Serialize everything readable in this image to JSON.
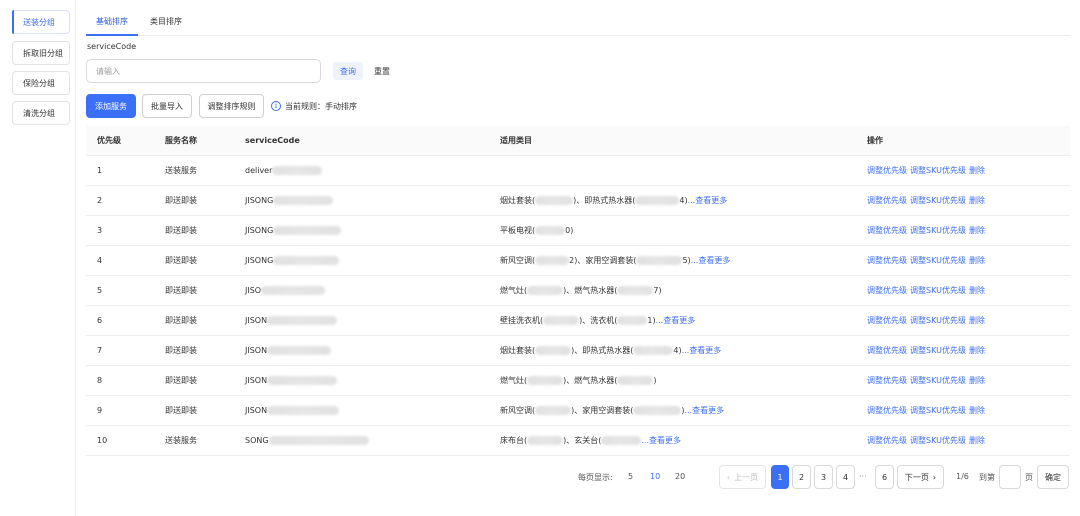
{
  "sidebar": {
    "items": [
      {
        "label": "送装分组",
        "active": true
      },
      {
        "label": "拆取旧分组",
        "active": false
      },
      {
        "label": "保险分组",
        "active": false
      },
      {
        "label": "清洗分组",
        "active": false
      }
    ]
  },
  "tabs": [
    {
      "label": "基础排序",
      "active": true
    },
    {
      "label": "类目排序",
      "active": false
    }
  ],
  "filter": {
    "label": "serviceCode",
    "placeholder": "请输入",
    "value": "",
    "query_label": "查询",
    "reset_label": "重置"
  },
  "actions": {
    "add_label": "添加服务",
    "import_label": "批量导入",
    "adjust_rule_label": "调整排序规则",
    "current_rule_text": "当前规则：手动排序"
  },
  "table": {
    "headers": [
      "优先级",
      "服务名称",
      "serviceCode",
      "适用类目",
      "操作"
    ],
    "rows": [
      {
        "priority": "1",
        "name": "送装服务",
        "code": "deliver",
        "category": "",
        "more": ""
      },
      {
        "priority": "2",
        "name": "即送即装",
        "code": "JISONG",
        "category_parts": [
          "烟灶套装(",
          ")、即热式热水器(",
          "4)"
        ],
        "category": "",
        "more": "...查看更多"
      },
      {
        "priority": "3",
        "name": "即送即装",
        "code": "JISONG",
        "category_parts": [
          "平板电视(",
          "0)"
        ],
        "category": "",
        "more": ""
      },
      {
        "priority": "4",
        "name": "即送即装",
        "code": "JISONG",
        "category_parts": [
          "新风空调(",
          "2)、家用空调套装(",
          "5)"
        ],
        "category": "",
        "more": "...查看更多"
      },
      {
        "priority": "5",
        "name": "即送即装",
        "code": "JISO",
        "category_parts": [
          "燃气灶(",
          ")、燃气热水器(",
          "7)"
        ],
        "category": "",
        "more": ""
      },
      {
        "priority": "6",
        "name": "即送即装",
        "code": "JISON",
        "category_parts": [
          "壁挂洗衣机(",
          ")、洗衣机(",
          "1)"
        ],
        "category": "",
        "more": "...查看更多"
      },
      {
        "priority": "7",
        "name": "即送即装",
        "code": "JISON",
        "category_parts": [
          "烟灶套装(",
          ")、即热式热水器(",
          "4)"
        ],
        "category": "",
        "more": "...查看更多"
      },
      {
        "priority": "8",
        "name": "即送即装",
        "code": "JISON",
        "category_parts": [
          "燃气灶(",
          ")、燃气热水器(",
          ")"
        ],
        "category": "",
        "more": ""
      },
      {
        "priority": "9",
        "name": "即送即装",
        "code": "JISON",
        "category_parts": [
          "新风空调(",
          ")、家用空调套装(",
          ")"
        ],
        "category": "",
        "more": "...查看更多"
      },
      {
        "priority": "10",
        "name": "送装服务",
        "code": "SONG",
        "category_parts": [
          "床布台(",
          ")、玄关台(",
          ""
        ],
        "category": "",
        "more": "...查看更多"
      }
    ],
    "row_actions": [
      "调整优先级",
      "调整SKU优先级",
      "删除"
    ]
  },
  "pagination": {
    "page_size_label": "每页显示:",
    "page_sizes": [
      "5",
      "10",
      "20"
    ],
    "active_page_size": "10",
    "prev_label": "上一页",
    "next_label": "下一页",
    "pages": [
      "1",
      "2",
      "3",
      "4"
    ],
    "ellipsis": "···",
    "last_page": "6",
    "active_page": "1",
    "page_info": "1/6",
    "goto_label": "到第",
    "page_unit": "页",
    "confirm_label": "确定"
  },
  "colors": {
    "accent": "#3b6ff5"
  }
}
